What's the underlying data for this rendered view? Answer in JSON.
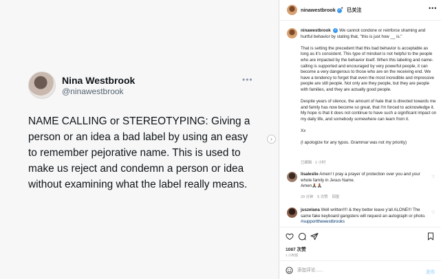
{
  "tweet": {
    "name": "Nina Westbrook",
    "handle": "@ninawestbrook",
    "more": "•••",
    "text": "NAME CALLING or STEREOTYPING: Giving a person or an idea a bad label by using an easy to remember pejorative name. This is used to make us reject and condemn a person or idea without examining what the label really means."
  },
  "carousel": {
    "next_glyph": "›"
  },
  "header": {
    "username": "ninawestbrook",
    "separator": "•",
    "follow_status": "已关注",
    "more": "•••"
  },
  "caption": {
    "username": "ninawestbrook",
    "p1": "We cannot condone or reinforce shaming and hurtful behavior by stating that, \"this is just how __ is.\"",
    "p2": "That is setting the precedent that this bad behavior is acceptable as long as it's consistent. This type of mindset is not helpful to the people who are impacted by the behavior itself. When this labeling and name-calling is supported and encouraged by very powerful people, it can become a very dangerous to those who are on the receiving end. We have a tendency to forget that even the most incredible and impressive people are still people. Not only are they people, but they are people with families, and they are actually good people.",
    "p3": "Despite years of silence, the amount of hate that is directed towards me and family has now become so great, that I'm forced to acknowledge it. My hope is that it does not continue to have such a significant impact on my daily life, and somebody somewhere can learn from it.",
    "p4": "Xx",
    "p5": "(I apologize for any typos. Grammar was not my priority)",
    "meta": "已编辑 · 1 小时"
  },
  "comments": [
    {
      "username": "lisaleslie",
      "text": "Amen! I pray a prayer of protection over you and your whole family in Jesus Name.",
      "text2": "Amen🙏🏾🙏🏾",
      "time": "29 分钟",
      "likes": "5 次赞",
      "reply": "回复"
    },
    {
      "username": "juszelana",
      "text": "Well written!!!! & they better leave y'all ALONE!!! The same fake keyboard gangsters will request an autograph or photo.",
      "hashtag": "#supportthewestbrooks"
    }
  ],
  "actions": {
    "likes": "1087 次赞",
    "posted": "1 小时前"
  },
  "comment_box": {
    "placeholder": "添加评论......",
    "post_label": "发布"
  }
}
